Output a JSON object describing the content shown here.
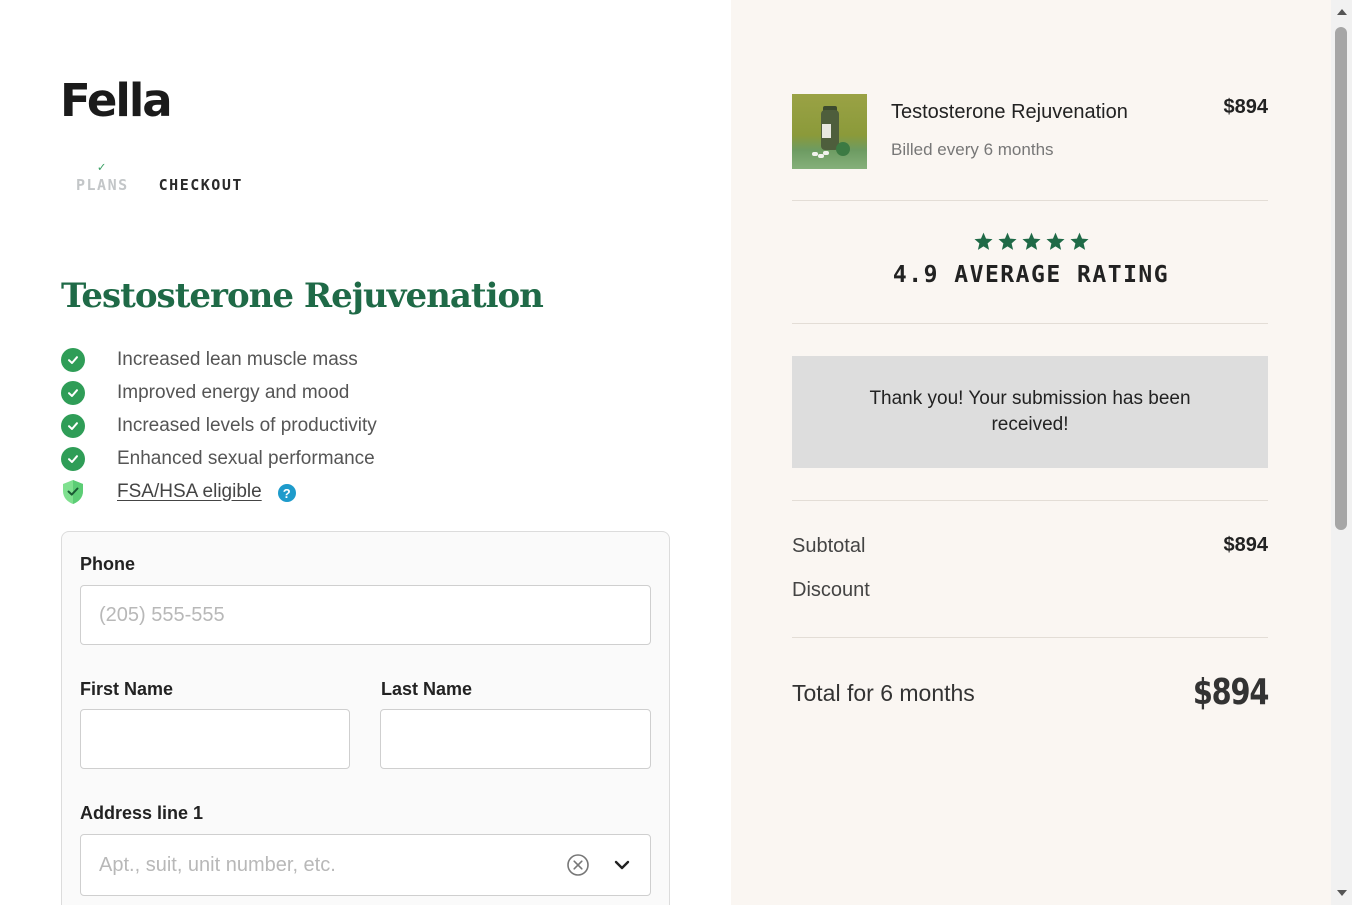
{
  "brand": {
    "logo_text": "Fella"
  },
  "steps": [
    {
      "label": "PLANS",
      "state": "done"
    },
    {
      "label": "CHECKOUT",
      "state": "active"
    }
  ],
  "plan": {
    "title": "Testosterone Rejuvenation",
    "benefits": [
      "Increased lean muscle mass",
      "Improved energy and mood",
      "Increased levels of productivity",
      "Enhanced sexual performance"
    ],
    "fsa_label": "FSA/HSA eligible",
    "help_glyph": "?"
  },
  "form": {
    "phone": {
      "label": "Phone",
      "placeholder": "(205) 555-555",
      "value": ""
    },
    "first_name": {
      "label": "First Name",
      "placeholder": "",
      "value": ""
    },
    "last_name": {
      "label": "Last Name",
      "placeholder": "",
      "value": ""
    },
    "address1": {
      "label": "Address line 1",
      "placeholder": "Apt., suit, unit number, etc.",
      "value": ""
    }
  },
  "order": {
    "product_name": "Testosterone Rejuvenation",
    "billing": "Billed every 6 months",
    "price": "$894",
    "rating_stars": 5,
    "rating_text": "4.9 AVERAGE RATING",
    "success_message": "Thank you! Your submission has been received!",
    "subtotal_label": "Subtotal",
    "subtotal_value": "$894",
    "discount_label": "Discount",
    "discount_value": "",
    "total_label": "Total for 6 months",
    "total_value": "$894"
  },
  "colors": {
    "brand_green": "#1f6a47",
    "check_green": "#2f9d57",
    "help_blue": "#1e9bcb",
    "summary_bg": "#faf6f2",
    "success_bg": "#dddddd"
  },
  "icons": {
    "benefit": "check-circle-icon",
    "fsa": "shield-check-icon",
    "help": "help-icon",
    "star": "star-icon",
    "clear": "clear-icon",
    "dropdown": "chevron-down-icon"
  }
}
